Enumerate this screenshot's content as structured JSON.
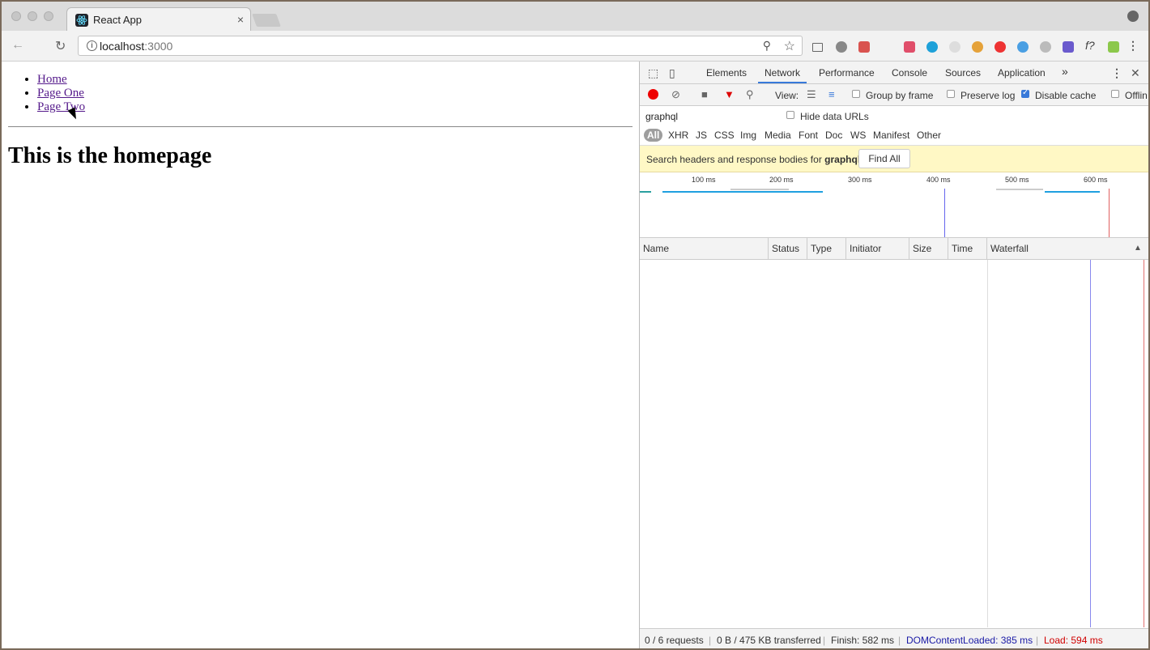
{
  "browser": {
    "tab_title": "React App",
    "tab_close": "×",
    "url_host": "localhost",
    "url_port": ":3000",
    "icons": [
      "back-icon",
      "reload-icon",
      "info-icon",
      "zoom-icon",
      "star-icon",
      "menu-icon",
      "profile-icon"
    ]
  },
  "page": {
    "nav": [
      "Home",
      "Page One",
      "Page Two"
    ],
    "heading": "This is the homepage"
  },
  "devtools": {
    "tabs": [
      "Elements",
      "Network",
      "Performance",
      "Console",
      "Sources",
      "Application"
    ],
    "active_tab": "Network",
    "more_tabs": "»",
    "view_label": "View:",
    "group_by_frame": "Group by frame",
    "preserve_log": "Preserve log",
    "disable_cache": "Disable cache",
    "offline": "Offlin",
    "filter_value": "graphql",
    "hide_data_urls": "Hide data URLs",
    "types": [
      "All",
      "XHR",
      "JS",
      "CSS",
      "Img",
      "Media",
      "Font",
      "Doc",
      "WS",
      "Manifest",
      "Other"
    ],
    "search_prefix": "Search headers and response bodies for ",
    "search_term": "graphql",
    "find_all": "Find All",
    "ruler": [
      "100 ms",
      "200 ms",
      "300 ms",
      "400 ms",
      "500 ms",
      "600 ms"
    ],
    "columns": [
      "Name",
      "Status",
      "Type",
      "Initiator",
      "Size",
      "Time",
      "Waterfall"
    ],
    "sort_indicator": "▲",
    "status": {
      "requests": "0 / 6 requests",
      "transferred": "0 B / 475 KB transferred",
      "finish": "Finish: 582 ms",
      "dom": "DOMContentLoaded: 385 ms",
      "load": "Load: 594 ms"
    },
    "colors": {
      "dom": "#1a1aa6",
      "load": "#d00000",
      "accent": "#3879d9"
    }
  }
}
